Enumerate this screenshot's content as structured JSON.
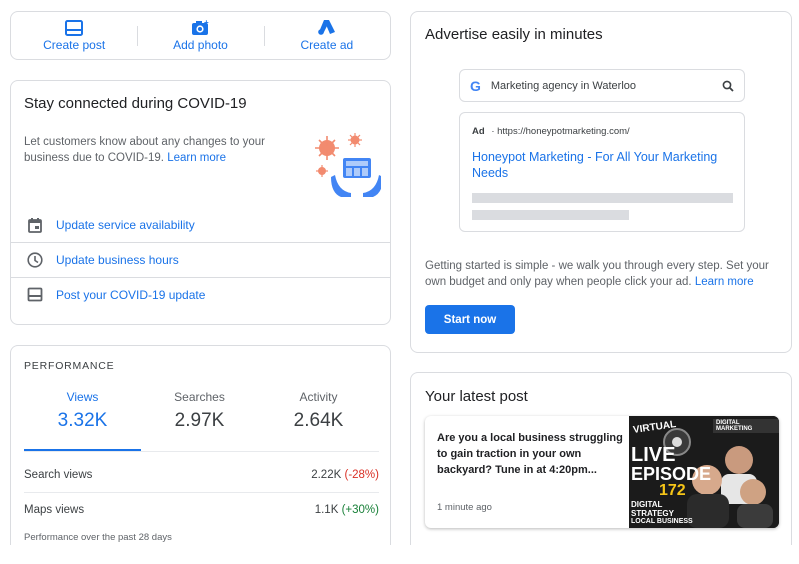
{
  "quick_actions": [
    {
      "label": "Create post",
      "icon": "post-icon"
    },
    {
      "label": "Add photo",
      "icon": "camera-icon"
    },
    {
      "label": "Create ad",
      "icon": "google-ads-icon"
    }
  ],
  "covid": {
    "title": "Stay connected during COVID-19",
    "description": "Let customers know about any changes to your business due to COVID-19.",
    "learn_more": "Learn more",
    "actions": [
      {
        "label": "Update service availability",
        "icon": "calendar-icon"
      },
      {
        "label": "Update business hours",
        "icon": "clock-icon"
      },
      {
        "label": "Post your COVID-19 update",
        "icon": "post-icon"
      }
    ]
  },
  "performance": {
    "header": "PERFORMANCE",
    "tabs": [
      {
        "label": "Views",
        "value": "3.32K",
        "active": true
      },
      {
        "label": "Searches",
        "value": "2.97K",
        "active": false
      },
      {
        "label": "Activity",
        "value": "2.64K",
        "active": false
      }
    ],
    "rows": [
      {
        "label": "Search views",
        "value": "2.22K",
        "change": "(-28%)",
        "trend": "negative"
      },
      {
        "label": "Maps views",
        "value": "1.1K",
        "change": "(+30%)",
        "trend": "positive"
      }
    ],
    "footer": "Performance over the past 28 days"
  },
  "advertise": {
    "title": "Advertise easily in minutes",
    "search_query": "Marketing agency in Waterloo",
    "ad_label": "Ad",
    "ad_url": "https://honeypotmarketing.com/",
    "ad_headline": "Honeypot Marketing - For All Your Marketing Needs",
    "body": "Getting started is simple - we walk you through every step. Set your own budget and only pay when people click your ad.",
    "learn_more": "Learn more",
    "button": "Start now"
  },
  "latest_post": {
    "title": "Your latest post",
    "text": "Are you a local business struggling to gain traction in your own backyard? Tune in at 4:20pm...",
    "time": "1 minute ago",
    "thumbnail": {
      "line1": "VIRTUAL",
      "line2": "LIVE",
      "line3": "EPISODE",
      "number": "172",
      "banner": "DIGITAL MARKETING",
      "bottom1": "DIGITAL",
      "bottom2": "STRATEGY",
      "bottom3": "LOCAL BUSINESS"
    }
  },
  "colors": {
    "accent": "#1a73e8",
    "negative": "#d93025",
    "positive": "#188038",
    "border": "#dadce0"
  }
}
